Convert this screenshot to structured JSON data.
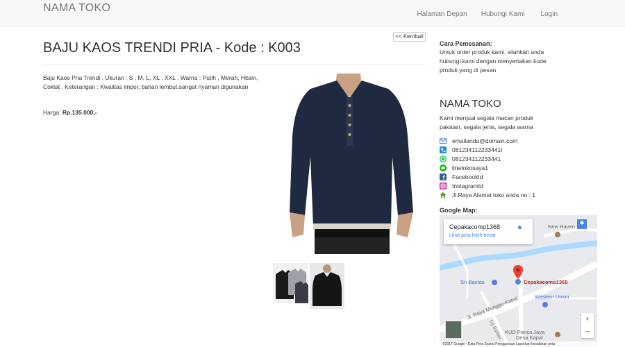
{
  "navbar": {
    "brand": "NAMA TOKO",
    "links": [
      "Halaman Depan",
      "Hubungi Kami",
      "Login"
    ]
  },
  "product": {
    "back_label": "<< Kembali",
    "title": "BAJU KAOS TRENDI PRIA - Kode : K003",
    "description": "Baju Kaos Pria Trendi . Ukuran : S , M, L, XL , XXL . Warna : Putih , Merah, Hitam, Coklat . Keterangan : Kwalitas impor, bahan lembut,sangat nyaman digunakan",
    "price_label": "Harga:",
    "price_value": "Rp.135.000,-"
  },
  "sidebar": {
    "order_title": "Cara Pemesanan:",
    "order_text": "Untuk order produk kami, silahkan anda hubungi kami dengan menyertakan kode produk yang di pesan",
    "shop_name": "NAMA TOKO",
    "shop_desc": "Kami menjual segala macan produk pakaian, segala jenis, segala warna",
    "contacts": [
      {
        "icon": "email-icon",
        "text": "emailanda@domain.com",
        "color": "#3b7dd8"
      },
      {
        "icon": "phone-icon",
        "text": "081234112233441l",
        "color": "#1a8ed8"
      },
      {
        "icon": "whatsapp-icon",
        "text": "081234112233441",
        "color": "#25d366"
      },
      {
        "icon": "line-icon",
        "text": "linetokosaya1",
        "color": "#00c300"
      },
      {
        "icon": "facebook-icon",
        "text": "FacebookId",
        "color": "#3b5998"
      },
      {
        "icon": "instagram-icon",
        "text": "InstagramId",
        "color": "#d6249f"
      },
      {
        "icon": "home-icon",
        "text": "Jl.Raya Alamat toko anda no : 1",
        "color": "#5aa02c"
      }
    ],
    "map_title": "Google Map:",
    "map": {
      "card_title": "Cepakacomp1368",
      "card_link": "Lihat peta lebih besar",
      "place_new_haven": "New Haven",
      "place_sri_bantas": "Sri Bantas",
      "place_marker": "Cepakacomp1368",
      "place_western_union": "Western Union",
      "road": "Jl. Raya Munggu-Kapal",
      "road2": "Gg Bantas",
      "place_kud": "KUD Panca Jaya",
      "place_kud2": "Desa Kapal",
      "zoom_in": "+",
      "zoom_out": "−",
      "footer": "©2017 Google - Data Peta    Syarat Penggunaan    Laporkan kesalahan peta"
    }
  }
}
